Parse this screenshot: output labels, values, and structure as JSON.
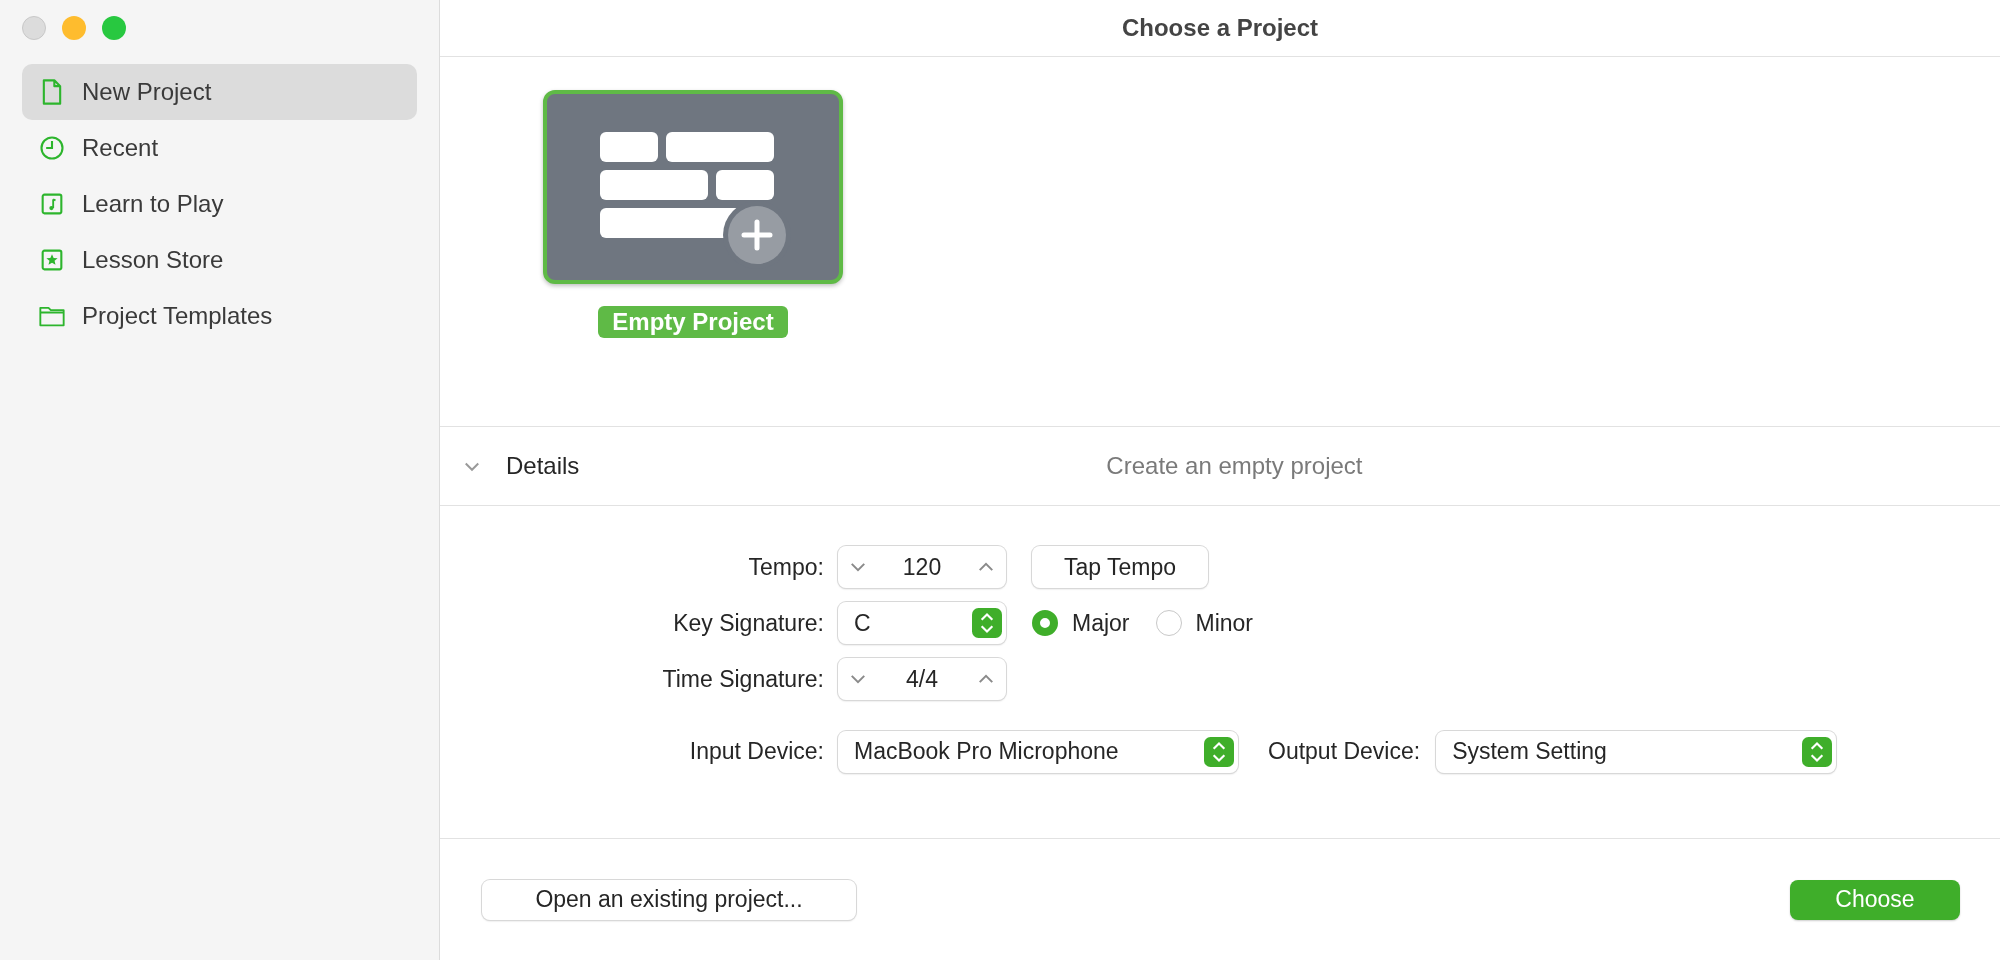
{
  "window": {
    "title": "Choose a Project"
  },
  "sidebar": {
    "items": [
      {
        "label": "New Project",
        "kind": "document",
        "selected": true
      },
      {
        "label": "Recent",
        "kind": "clock",
        "selected": false
      },
      {
        "label": "Learn to Play",
        "kind": "music",
        "selected": false
      },
      {
        "label": "Lesson Store",
        "kind": "star",
        "selected": false
      },
      {
        "label": "Project Templates",
        "kind": "folder",
        "selected": false
      }
    ]
  },
  "templates": [
    {
      "label": "Empty Project",
      "selected": true
    }
  ],
  "details": {
    "label": "Details",
    "expanded": true,
    "description": "Create an empty project"
  },
  "form": {
    "rows": [
      {
        "kind": "stepper",
        "label": "Tempo:",
        "value": "120",
        "button": "Tap Tempo"
      },
      {
        "kind": "select",
        "label": "Key Signature:",
        "value": "C",
        "radios": [
          {
            "label": "Major",
            "selected": true
          },
          {
            "label": "Minor",
            "selected": false
          }
        ]
      },
      {
        "kind": "stepper",
        "label": "Time Signature:",
        "value": "4/4"
      }
    ],
    "devices": [
      {
        "label": "Input Device:",
        "value": "MacBook Pro Microphone"
      },
      {
        "label": "Output Device:",
        "value": "System Setting"
      }
    ]
  },
  "footer": {
    "open_button": "Open an existing project...",
    "choose_button": "Choose"
  }
}
